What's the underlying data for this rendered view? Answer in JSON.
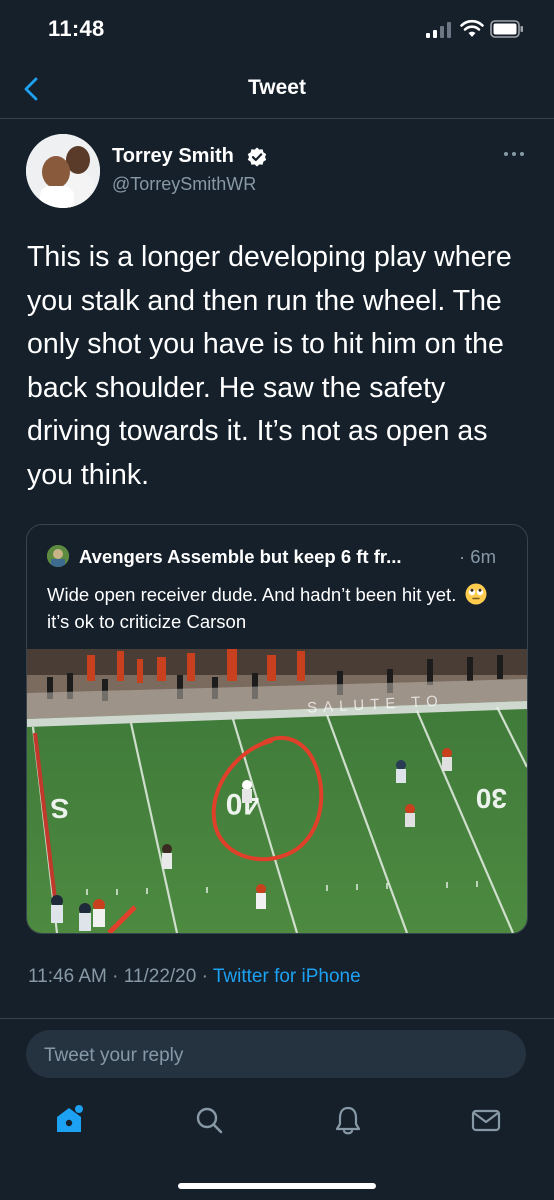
{
  "status_bar": {
    "time": "11:48"
  },
  "header": {
    "title": "Tweet"
  },
  "tweet": {
    "author_name": "Torrey Smith",
    "author_handle": "@TorreySmithWR",
    "text": "This is a longer developing play where you stalk and then run the wheel. The only shot you have is to hit him on the back shoulder. He saw the safety driving towards it. It’s not as open as you think.",
    "timestamp": "11:46 AM · 11/22/20 · ",
    "source": "Twitter for iPhone"
  },
  "quote": {
    "author_name": "Avengers Assemble but keep 6 ft fr...",
    "time": "· 6m",
    "text_before_emoji": "Wide open receiver dude. And hadn’t been hit yet.",
    "text_after_emoji": "it’s ok to criticize Carson",
    "field_banner_text": "SALUTE TO",
    "yard_markers": [
      "40",
      "30",
      "S"
    ]
  },
  "reply": {
    "placeholder": "Tweet your reply"
  },
  "colors": {
    "background": "#15202b",
    "accent": "#1da1f2",
    "secondary_text": "#8899a6",
    "border": "#38444d"
  },
  "icons": [
    "back-chevron-icon",
    "verified-badge-icon",
    "more-icon",
    "home-icon",
    "search-icon",
    "notifications-bell-icon",
    "messages-envelope-icon"
  ]
}
